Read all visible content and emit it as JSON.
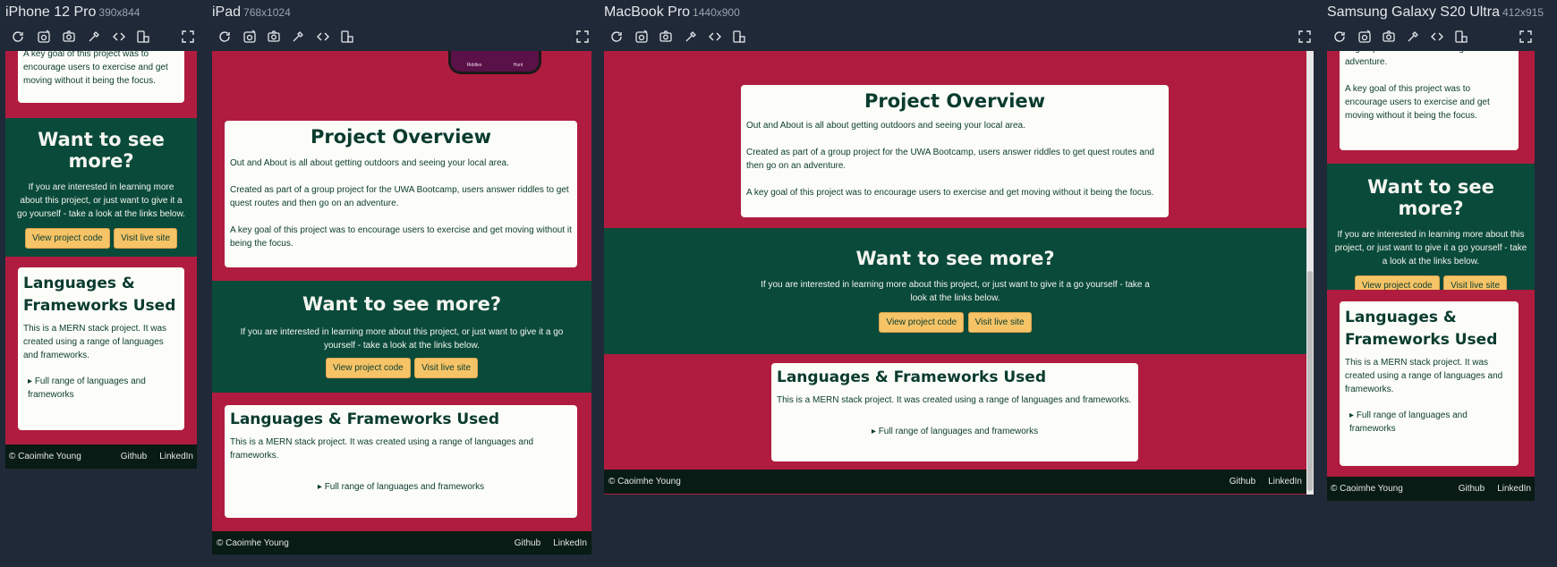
{
  "devices": {
    "iphone": {
      "name": "iPhone 12 Pro",
      "dims": "390x844"
    },
    "ipad": {
      "name": "iPad",
      "dims": "768x1024"
    },
    "macbook": {
      "name": "MacBook Pro",
      "dims": "1440x900"
    },
    "samsung": {
      "name": "Samsung Galaxy S20 Ultra",
      "dims": "412x915"
    }
  },
  "toolbar_icons": [
    "refresh-icon",
    "screenshot-icon",
    "camera-icon",
    "eyedropper-icon",
    "code-icon",
    "rotate-icon",
    "fullscreen-icon"
  ],
  "site": {
    "overview_title": "Project Overview",
    "overview_p1": "Out and About is all about getting outdoors and seeing your local area.",
    "overview_p2": "Created as part of a group project for the UWA Bootcamp, users answer riddles to get quest routes and then go on an adventure.",
    "overview_p3": "A key goal of this project was to encourage users to exercise and get moving without it being the focus.",
    "overview_p2_tail": "to get quest routes and then go on an adventure.",
    "more_title": "Want to see more?",
    "more_text": "If you are interested in learning more about this project, or just want to give it a go yourself - take a look at the links below.",
    "btn_code": "View project code",
    "btn_live": "Visit live site",
    "lang_title": "Languages & Frameworks Used",
    "lang_text": "This is a MERN stack project. It was created using a range of languages and frameworks.",
    "lang_details": "Full range of languages and frameworks",
    "footer_copy": "© Caoimhe Young",
    "footer_github": "Github",
    "footer_linkedin": "LinkedIn",
    "phone_nav_1": "Riddles",
    "phone_nav_2": "Hunt"
  },
  "colors": {
    "red": "#b01c3f",
    "green": "#0a4a3a",
    "button": "#f6c466",
    "card": "#fcfdf8",
    "footer": "#081b14",
    "background": "#1f2937"
  }
}
